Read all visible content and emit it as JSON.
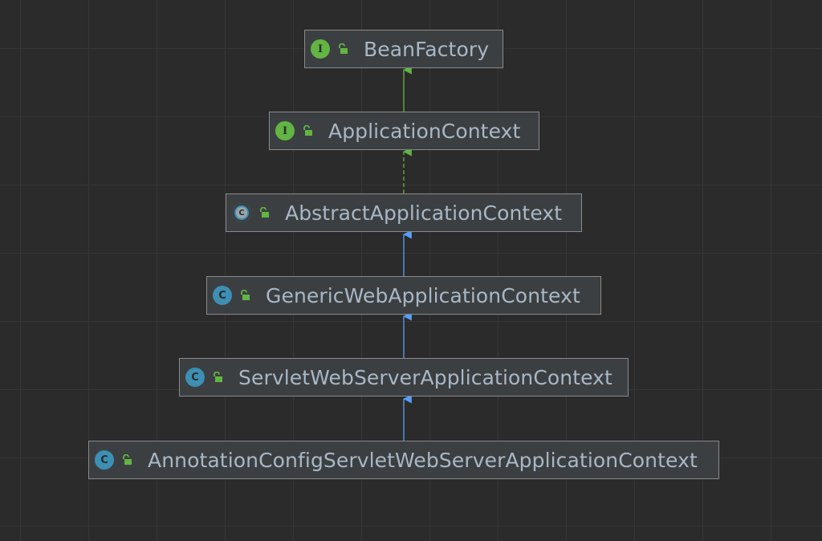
{
  "diagram": {
    "nodes": [
      {
        "id": "bean-factory",
        "label": "BeanFactory",
        "kind": "interface",
        "icon_letter": "I"
      },
      {
        "id": "application-context",
        "label": "ApplicationContext",
        "kind": "interface",
        "icon_letter": "I"
      },
      {
        "id": "abstract-application-context",
        "label": "AbstractApplicationContext",
        "kind": "abstract-class",
        "icon_letter": "C"
      },
      {
        "id": "generic-web-application-context",
        "label": "GenericWebApplicationContext",
        "kind": "class",
        "icon_letter": "C"
      },
      {
        "id": "servlet-web-server-application-context",
        "label": "ServletWebServerApplicationContext",
        "kind": "class",
        "icon_letter": "C"
      },
      {
        "id": "annotation-config-servlet-web-server-application-context",
        "label": "AnnotationConfigServletWebServerApplicationContext",
        "kind": "class",
        "icon_letter": "C"
      }
    ],
    "edges": [
      {
        "from": "application-context",
        "to": "bean-factory",
        "type": "interface-extends"
      },
      {
        "from": "abstract-application-context",
        "to": "application-context",
        "type": "implements"
      },
      {
        "from": "generic-web-application-context",
        "to": "abstract-application-context",
        "type": "class-extends"
      },
      {
        "from": "servlet-web-server-application-context",
        "to": "generic-web-application-context",
        "type": "class-extends"
      },
      {
        "from": "annotation-config-servlet-web-server-application-context",
        "to": "servlet-web-server-application-context",
        "type": "class-extends"
      }
    ],
    "icons": {
      "interface": "interface-icon",
      "class": "class-icon",
      "abstract-class": "abstract-class-icon",
      "visibility": "public-lock-icon"
    },
    "colors": {
      "background": "#2b2b2b",
      "node_fill": "#3c3f41",
      "node_border": "#8a8a8a",
      "text": "#a9b7c6",
      "interface_icon": "#62b543",
      "class_icon": "#3d8fb3",
      "lock": "#62b543",
      "interface_edge": "#62b543",
      "class_edge": "#589df6"
    }
  }
}
